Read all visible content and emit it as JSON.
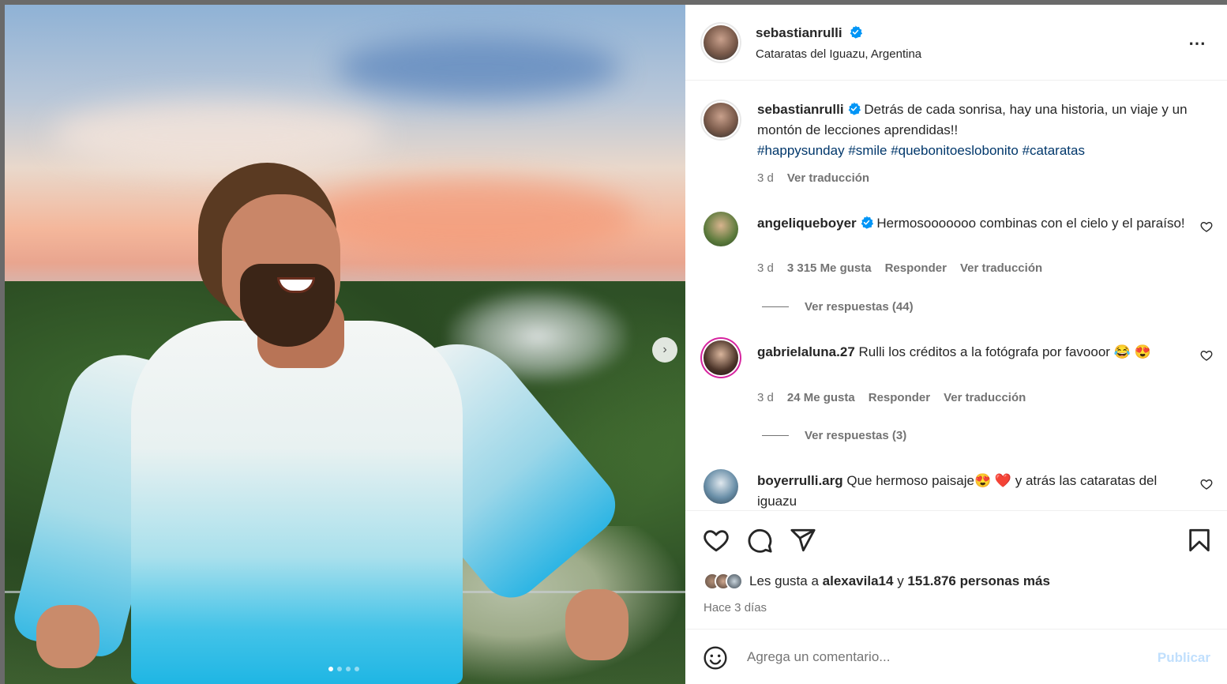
{
  "post": {
    "author": "sebastianrulli",
    "location": "Cataratas del Iguazu, Argentina",
    "more_icon": "⋯",
    "caption": "Detrás de cada sonrisa, hay una historia, un viaje y un montón de lecciones aprendidas!!",
    "hashtags": [
      "#happysunday",
      "#smile",
      "#quebonitoeslobonito",
      "#cataratas"
    ],
    "caption_age": "3 d",
    "translate": "Ver traducción"
  },
  "comments": [
    {
      "user": "angeliqueboyer",
      "verified": true,
      "text": "Hermosooooooo combinas con el cielo y el paraíso!",
      "age": "3 d",
      "likes": "3 315 Me gusta",
      "reply": "Responder",
      "translate": "Ver traducción",
      "replies": "Ver respuestas (44)"
    },
    {
      "user": "gabrielaluna.27",
      "verified": false,
      "text": "Rulli los créditos a la fotógrafa por favooor 😂 😍",
      "age": "3 d",
      "likes": "24 Me gusta",
      "reply": "Responder",
      "translate": "Ver traducción",
      "replies": "Ver respuestas (3)"
    },
    {
      "user": "boyerrulli.arg",
      "verified": false,
      "text": "Que hermoso paisaje😍 ❤️  y atrás las cataratas del iguazu"
    }
  ],
  "footer": {
    "likes_prefix": "Les gusta a",
    "likes_user": "alexavila14",
    "likes_joiner": "y",
    "likes_rest": "151.876 personas más",
    "date": "Hace 3 días",
    "comment_placeholder": "Agrega un comentario...",
    "publish": "Publicar"
  },
  "carousel": {
    "next_icon": "›",
    "slides": 4,
    "active": 1
  },
  "colors": {
    "verified": "#0095f6",
    "hashtag": "#00376b",
    "muted": "#737373",
    "publish_disabled": "#c0dffd",
    "story_ring": "#d6249f"
  }
}
